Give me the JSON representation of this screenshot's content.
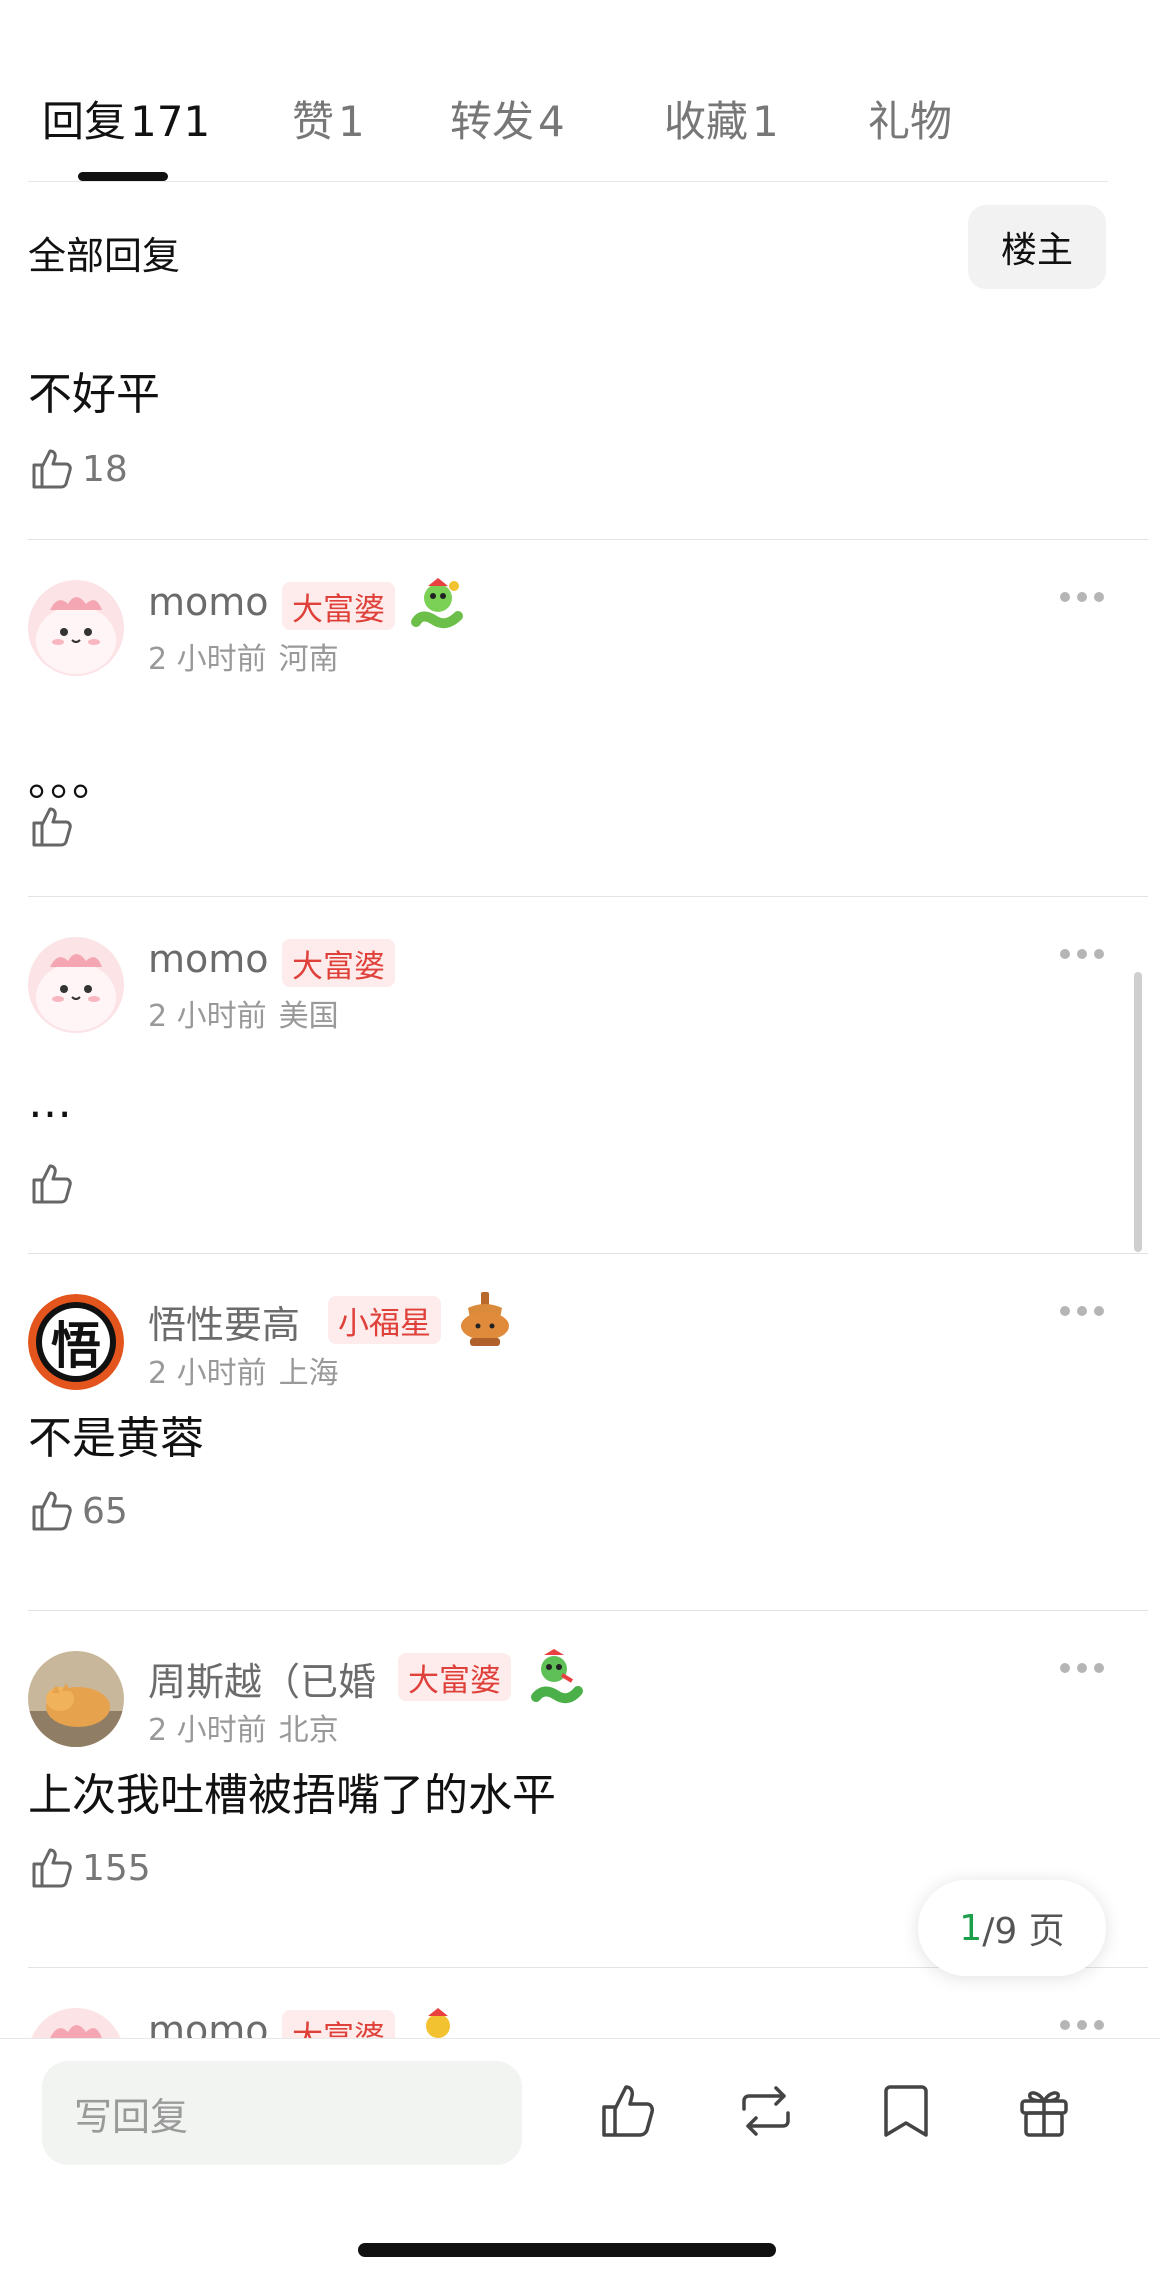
{
  "tabs": [
    {
      "label": "回复",
      "count": "171"
    },
    {
      "label": "赞",
      "count": "1"
    },
    {
      "label": "转发",
      "count": "4"
    },
    {
      "label": "收藏",
      "count": "1"
    },
    {
      "label": "礼物",
      "count": ""
    }
  ],
  "filter": {
    "title": "全部回复",
    "op_button": "楼主"
  },
  "comments": [
    {
      "content": "不好平",
      "likes": "18"
    },
    {
      "username": "momo",
      "badge": "大富婆",
      "time": "2 小时前",
      "location": "河南",
      "content": "。。。",
      "likes": ""
    },
    {
      "username": "momo",
      "badge": "大富婆",
      "time": "2 小时前",
      "location": "美国",
      "content": "…",
      "likes": ""
    },
    {
      "username": "悟性要高",
      "badge": "小福星",
      "time": "2 小时前",
      "location": "上海",
      "content": "不是黄蓉",
      "likes": "65"
    },
    {
      "username": "周斯越（已婚",
      "badge": "大富婆",
      "time": "2 小时前",
      "location": "北京",
      "content": "上次我吐槽被捂嘴了的水平",
      "likes": "155"
    },
    {
      "username": "momo",
      "badge": "大富婆"
    }
  ],
  "avatar_glyphs": {
    "wuxing": "悟"
  },
  "pagination": {
    "current": "1",
    "total": "/9 页"
  },
  "bottom_bar": {
    "reply_placeholder": "写回复"
  },
  "colors": {
    "badge_text": "#e0403a",
    "badge_bg": "#fdeceb",
    "page_current": "#1c9e4a"
  }
}
